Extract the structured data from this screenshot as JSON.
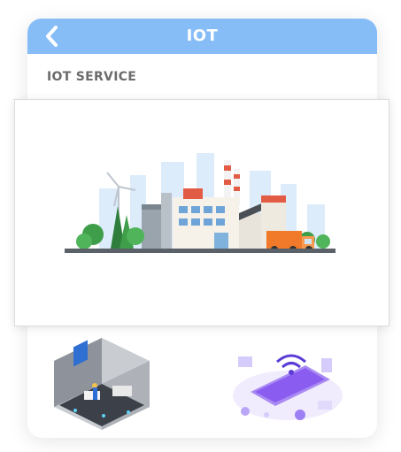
{
  "header": {
    "title": "IOT",
    "back_icon": "chevron-left-icon",
    "background": "#86bdf7"
  },
  "section": {
    "title": "IOT SERVICE"
  },
  "cards": [
    {
      "icon": "smart-factory-illustration"
    },
    {
      "icon": "smart-home-room-illustration"
    },
    {
      "icon": "smartphone-wireless-devices-illustration"
    }
  ],
  "colors": {
    "accent": "#86bdf7",
    "section_text": "#6b6b6b",
    "truck": "#f07a2a",
    "trees": "#3f9e4a",
    "device_purple": "#8a5cf0"
  }
}
